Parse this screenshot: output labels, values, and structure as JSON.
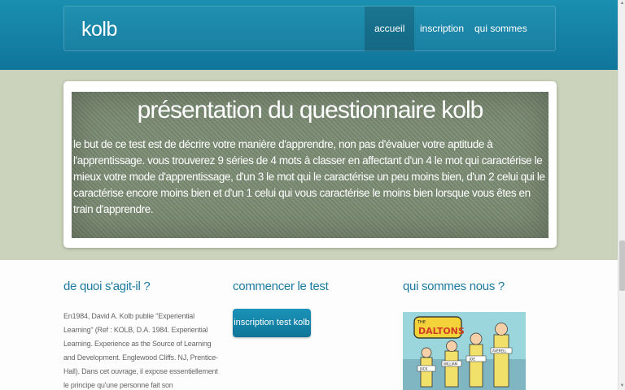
{
  "header": {
    "brand": "kolb",
    "nav": [
      {
        "label": "accueil",
        "active": true
      },
      {
        "label": "inscription",
        "active": false
      },
      {
        "label": "qui sommes nous",
        "active": false
      }
    ]
  },
  "hero": {
    "title": "présentation du questionnaire kolb",
    "text": "le but de ce test est de décrire votre manière d'apprendre, non pas d'évaluer votre aptitude à l'apprentissage. vous trouverez 9 séries de 4 mots à classer en affectant d'un 4 le mot qui caractérise le mieux votre mode d'apprentissage, d'un 3 le mot qui le caractérise un peu moins bien, d'un 2 celui qui le caractérise encore moins bien et d'un 1 celui qui vous caractérise le moins bien lorsque vous êtes en train d'apprendre."
  },
  "columns": {
    "about": {
      "title": "de quoi s'agit-il ?",
      "text": "En1984, David A. Kolb publie \"Experiential Learning\" (Ref : KOLB, D.A. 1984. Experiential Learning. Experience as the Source of Learning and Development. Englewood Cliffs. NJ, Prentice-Hall). Dans cet ouvrage, il expose essentiellement le principe qu'une personne fait son apprentissage par la découverte et l'expérience."
    },
    "start": {
      "title": "commencer le test",
      "button": "inscription test kolb"
    },
    "who": {
      "title": "qui sommes nous ?",
      "poster_text": "THE DALTONS",
      "poster_tags": [
        "AVERELL",
        "JOE",
        "WILLIAM",
        "JACK"
      ]
    }
  },
  "colors": {
    "header_blue": "#1a8fb0",
    "hero_background": "#cbd3bc",
    "hero_panel": "#7b8b73",
    "heading_blue": "#1b7aa0"
  }
}
